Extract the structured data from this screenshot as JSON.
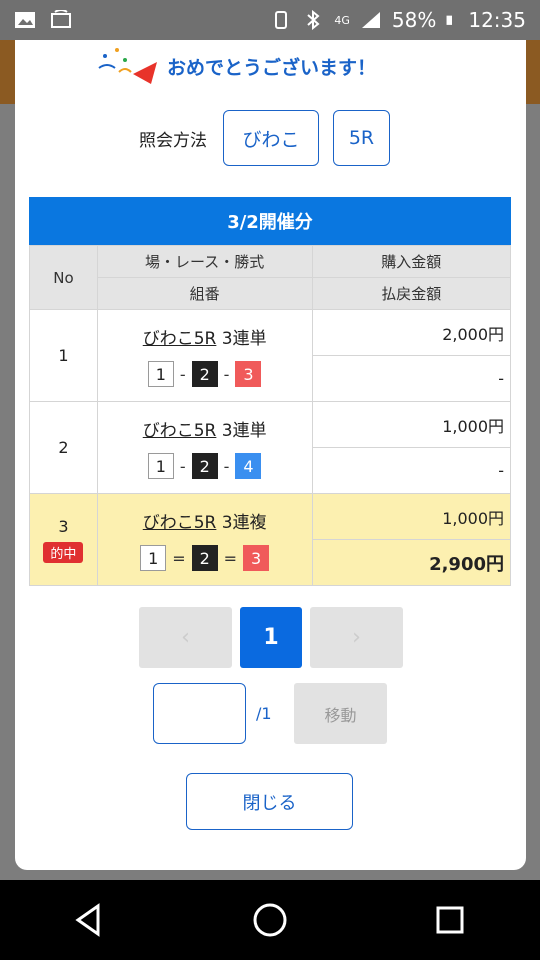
{
  "status": {
    "battery": "58%",
    "time": "12:35",
    "network": "4G"
  },
  "congrats": {
    "text": "おめでとうございます！"
  },
  "query": {
    "label": "照会方法",
    "place_button": "びわこ",
    "race_button": "5R"
  },
  "date_header": "3/2開催分",
  "table": {
    "headers": {
      "no": "No",
      "race": "場・レース・勝式",
      "buy": "購入金額",
      "combo": "組番",
      "payout": "払戻金額"
    },
    "rows": [
      {
        "no": "1",
        "place": "びわこ5R",
        "type": "3連単",
        "buy": "2,000円",
        "payout": "-",
        "nums": [
          "1",
          "2",
          "3"
        ],
        "sep": "-",
        "hit": false
      },
      {
        "no": "2",
        "place": "びわこ5R",
        "type": "3連単",
        "buy": "1,000円",
        "payout": "-",
        "nums": [
          "1",
          "2",
          "4"
        ],
        "sep": "-",
        "hit": false
      },
      {
        "no": "3",
        "place": "びわこ5R",
        "type": "3連複",
        "buy": "1,000円",
        "payout": "2,900円",
        "nums": [
          "1",
          "2",
          "3"
        ],
        "sep": "=",
        "hit": true,
        "badge": "的中"
      }
    ]
  },
  "pager": {
    "prev": "‹",
    "current": "1",
    "next": "›"
  },
  "jump": {
    "total": "/1",
    "button": "移動"
  },
  "close_button": "閉じる",
  "colors": {
    "accent": "#1a63c8",
    "header_blue": "#0a77e0",
    "hit_bg": "#fcf0b0",
    "badge_red": "#e03030"
  }
}
